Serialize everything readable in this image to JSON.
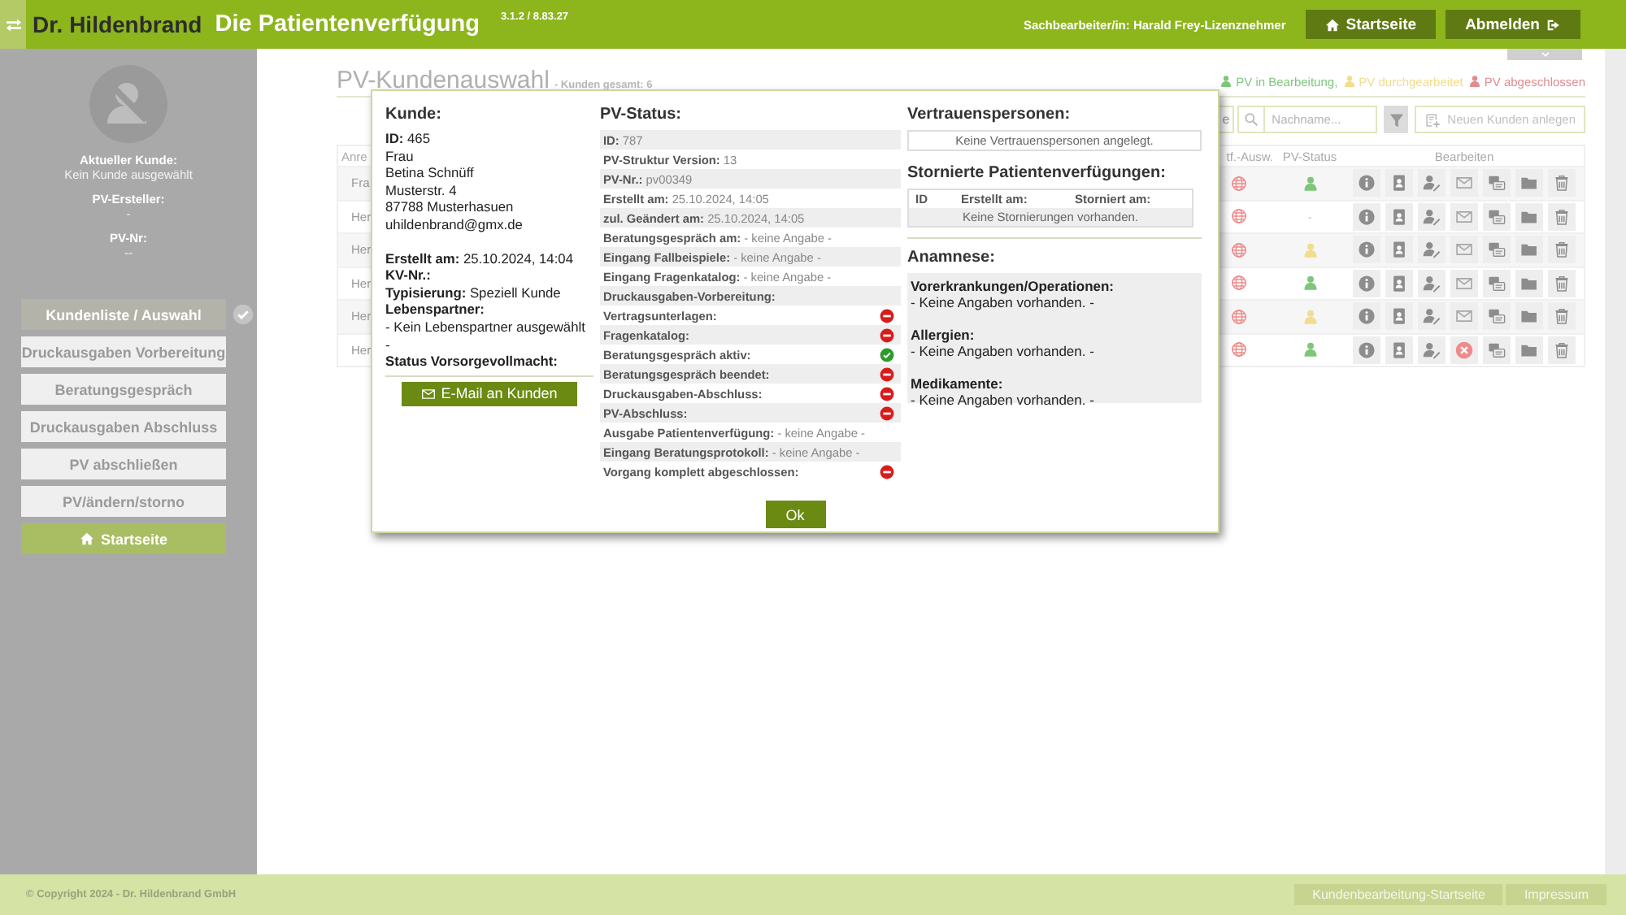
{
  "header": {
    "brand": "Dr. Hildenbrand",
    "app_title": "Die Patientenverfügung",
    "version": "3.1.2 / 8.83.27",
    "user": "Sachbearbeiter/in: Harald Frey-Lizenznehmer",
    "buttons": [
      {
        "label": "Startseite",
        "kind": "home"
      },
      {
        "label": "Abmelden",
        "kind": "logout"
      }
    ]
  },
  "sidebar": {
    "info": [
      {
        "label": "Aktueller Kunde:",
        "value": "Kein Kunde ausgewählt"
      },
      {
        "label": "PV-Ersteller:",
        "value": "-"
      },
      {
        "label": "PV-Nr:",
        "value": "--"
      }
    ],
    "nav": [
      {
        "label": "Kundenliste / Auswahl",
        "kind": "step",
        "selected": true,
        "done": true
      },
      {
        "label": "Druckausgaben Vorbereitung",
        "kind": "step",
        "selected": false,
        "done": false
      },
      {
        "label": "Beratungsgespräch",
        "kind": "step",
        "selected": false,
        "done": false
      },
      {
        "label": "Druckausgaben Abschluss",
        "kind": "step",
        "selected": false,
        "done": false
      },
      {
        "label": "PV abschließen",
        "kind": "step",
        "selected": false,
        "done": false
      },
      {
        "label": "PV/ändern/storno",
        "kind": "step",
        "selected": false,
        "done": false
      },
      {
        "label": "Startseite",
        "kind": "home",
        "selected": false,
        "done": false
      }
    ]
  },
  "main": {
    "title": "PV-Kundenauswahl",
    "count": "- Kunden gesamt: 6",
    "legend": [
      {
        "label": "PV in Bearbeitung,",
        "color": "#7ec77a"
      },
      {
        "label": "PV durchgearbeitet",
        "color": "#f1dd8c"
      },
      {
        "label": "PV abgeschlossen",
        "color": "#e08c8c"
      }
    ],
    "toolbar": {
      "partial_button": "e",
      "search_placeholder": "Nachname...",
      "new_button": "Neuen Kunden anlegen"
    },
    "table": {
      "columns": [
        "Anre",
        "tf.-Ausw.",
        "PV-Status",
        "Bearbeiten"
      ],
      "rows": [
        {
          "salutation": "Fra",
          "color": "#7ec77a",
          "mail_blocked": false
        },
        {
          "salutation": "Her",
          "status_text": "-",
          "mail_blocked": false
        },
        {
          "salutation": "Her",
          "color": "#f1dd8c",
          "mail_blocked": false
        },
        {
          "salutation": "Her",
          "color": "#7ec77a",
          "mail_blocked": false
        },
        {
          "salutation": "Her",
          "color": "#f1dd8c",
          "mail_blocked": false
        },
        {
          "salutation": "Her",
          "color": "#7ec77a",
          "mail_blocked": true
        }
      ]
    }
  },
  "dialog": {
    "customer": {
      "heading": "Kunde:",
      "address": [
        {
          "text": "**ID:** 465",
          "kind": "plain"
        },
        {
          "text": "Frau",
          "kind": "plain"
        },
        {
          "text": "Betina Schnüff",
          "kind": "plain"
        },
        {
          "text": "Musterstr. 4",
          "kind": "plain"
        },
        {
          "text": "87788 Musterhasuen",
          "kind": "plain"
        },
        {
          "text": "uhildenbrand@gmx.de",
          "kind": "plain"
        }
      ],
      "details": [
        {
          "text": "**Erstellt am:** 25.10.2024, 14:04",
          "kind": "plain"
        },
        {
          "text": "KV-Nr.:",
          "kind": "label"
        },
        {
          "text": "**Typisierung:** Speziell Kunde",
          "kind": "plain"
        },
        {
          "text": "Lebenspartner:",
          "kind": "label"
        },
        {
          "text": "- Kein Lebenspartner ausgewählt",
          "kind": "plain"
        },
        {
          "text": "-",
          "kind": "plain"
        },
        {
          "text": "Status Vorsorgevollmacht:",
          "kind": "label"
        }
      ],
      "email_button": "E-Mail an Kunden"
    },
    "status": {
      "heading": "PV-Status:",
      "rows": [
        {
          "text": "**ID:** 787",
          "kind": "text"
        },
        {
          "text": "**PV-Struktur Version:** 13",
          "kind": "text"
        },
        {
          "text": "**PV-Nr.:** pv00349",
          "kind": "text"
        },
        {
          "text": "**Erstellt am:** 25.10.2024, 14:05",
          "kind": "text"
        },
        {
          "text": "**zul. Geändert am:** 25.10.2024, 14:05",
          "kind": "text"
        },
        {
          "text": "**Beratungsgespräch am:** - keine Angabe -",
          "kind": "text"
        },
        {
          "text": "**Eingang Fallbeispiele:** - keine Angabe -",
          "kind": "text"
        },
        {
          "text": "**Eingang Fragenkatalog:** - keine Angabe -",
          "kind": "text"
        },
        {
          "text": "Druckausgaben-Vorbereitung:",
          "kind": "label"
        },
        {
          "text": "Vertragsunterlagen:",
          "kind": "flag",
          "ok": false
        },
        {
          "text": "Fragenkatalog:",
          "kind": "flag",
          "ok": false
        },
        {
          "text": "Beratungsgespräch aktiv:",
          "kind": "flag",
          "ok": true
        },
        {
          "text": "Beratungsgespräch beendet:",
          "kind": "flag",
          "ok": false
        },
        {
          "text": "Druckausgaben-Abschluss:",
          "kind": "flag",
          "ok": false
        },
        {
          "text": "PV-Abschluss:",
          "kind": "flag",
          "ok": false
        },
        {
          "text": "**Ausgabe Patientenverfügung:** - keine Angabe -",
          "kind": "text"
        },
        {
          "text": "**Eingang Beratungsprotokoll:** - keine Angabe -",
          "kind": "text"
        },
        {
          "text": "Vorgang komplett abgeschlossen:",
          "kind": "flag",
          "ok": false
        }
      ]
    },
    "trusted": {
      "heading": "Vertrauenspersonen:",
      "empty": "Keine Vertrauenspersonen angelegt."
    },
    "cancelled": {
      "heading": "Stornierte Patientenverfügungen:",
      "columns": [
        "ID",
        "Erstellt am:",
        "Storniert am:"
      ],
      "empty": "Keine Stornierungen vorhanden."
    },
    "anamnesis": {
      "heading": "Anamnese:",
      "sections": [
        {
          "title": "Vorerkrankungen/Operationen:",
          "text": "- Keine Angaben vorhanden. -"
        },
        {
          "title": "Allergien:",
          "text": "- Keine Angaben vorhanden. -"
        },
        {
          "title": "Medikamente:",
          "text": "- Keine Angaben vorhanden. -"
        }
      ]
    },
    "ok_button": "Ok"
  },
  "footer": {
    "copyright": "© Copyright 2024 - Dr. Hildenbrand GmbH",
    "links": [
      "Kundenbearbeitung-Startseite",
      "Impressum"
    ]
  }
}
